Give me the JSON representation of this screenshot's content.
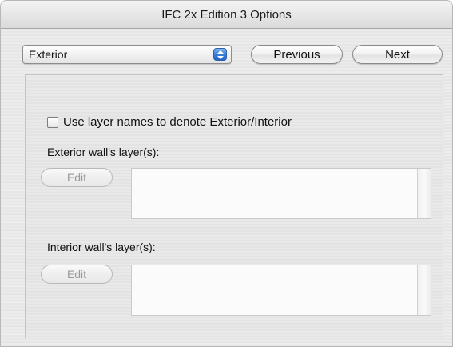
{
  "window": {
    "title": "IFC 2x Edition 3 Options"
  },
  "toolbar": {
    "category_popup": {
      "selected": "Exterior"
    },
    "previous_label": "Previous",
    "next_label": "Next"
  },
  "panel": {
    "use_layer_names": {
      "label": "Use layer names to denote Exterior/Interior",
      "checked": false
    },
    "exterior": {
      "label": "Exterior wall's layer(s):",
      "edit_label": "Edit",
      "edit_enabled": false,
      "layers": []
    },
    "interior": {
      "label": "Interior wall's layer(s):",
      "edit_label": "Edit",
      "edit_enabled": false,
      "layers": []
    }
  }
}
